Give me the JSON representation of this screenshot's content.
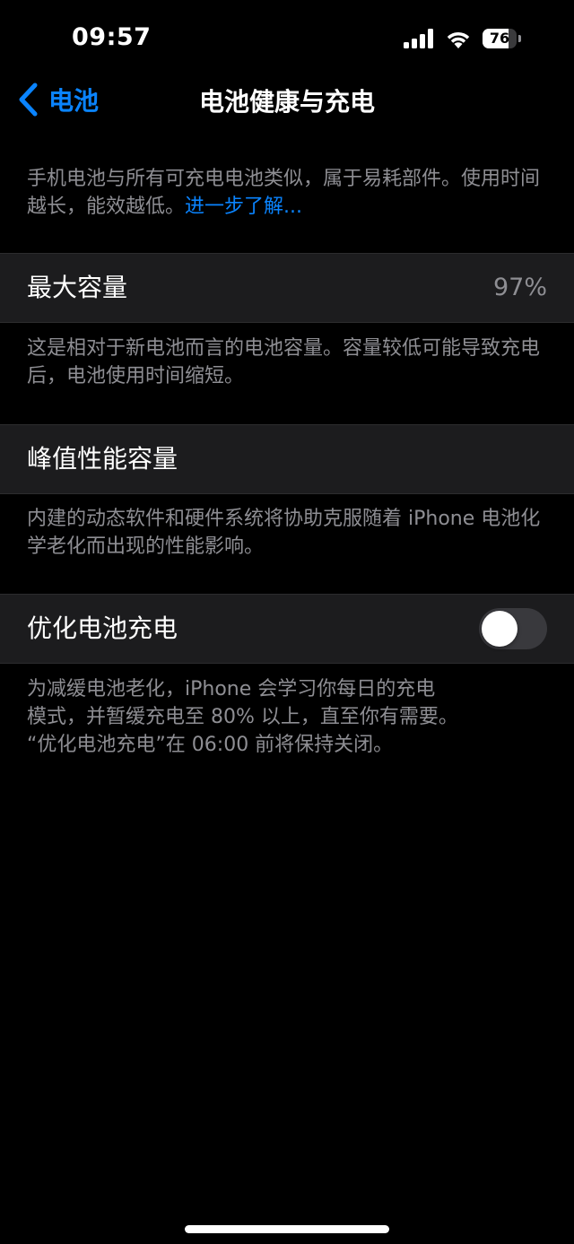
{
  "status_bar": {
    "time": "09:57",
    "battery_level": "76",
    "battery_fraction": 0.76,
    "icons": [
      "cellular-signal-icon",
      "wifi-icon",
      "battery-icon"
    ]
  },
  "nav": {
    "back_label": "电池",
    "back_icon": "chevron-left-icon",
    "title": "电池健康与充电"
  },
  "intro": {
    "text": "手机电池与所有可充电电池类似，属于易耗部件。使用时间越长，能效越低。",
    "link": "进一步了解..."
  },
  "max_capacity": {
    "label": "最大容量",
    "value": "97%",
    "footnote": "这是相对于新电池而言的电池容量。容量较低可能导致充电后，电池使用时间缩短。"
  },
  "peak_performance": {
    "label": "峰值性能容量",
    "footnote": "内建的动态软件和硬件系统将协助克服随着 iPhone 电池化学老化而出现的性能影响。"
  },
  "optimized_charging": {
    "label": "优化电池充电",
    "enabled": false,
    "footnote_line1": "为减缓电池老化，iPhone 会学习你每日的充电",
    "footnote_line2": "模式，并暂缓充电至 80% 以上，直至你有需要。",
    "footnote_line3": "“优化电池充电”在 06:00 前将保持关闭。"
  },
  "colors": {
    "background": "#000000",
    "cell_background": "#1c1c1e",
    "accent": "#0a84ff",
    "secondary_text": "#8e8e93",
    "toggle_off": "#39393d"
  }
}
